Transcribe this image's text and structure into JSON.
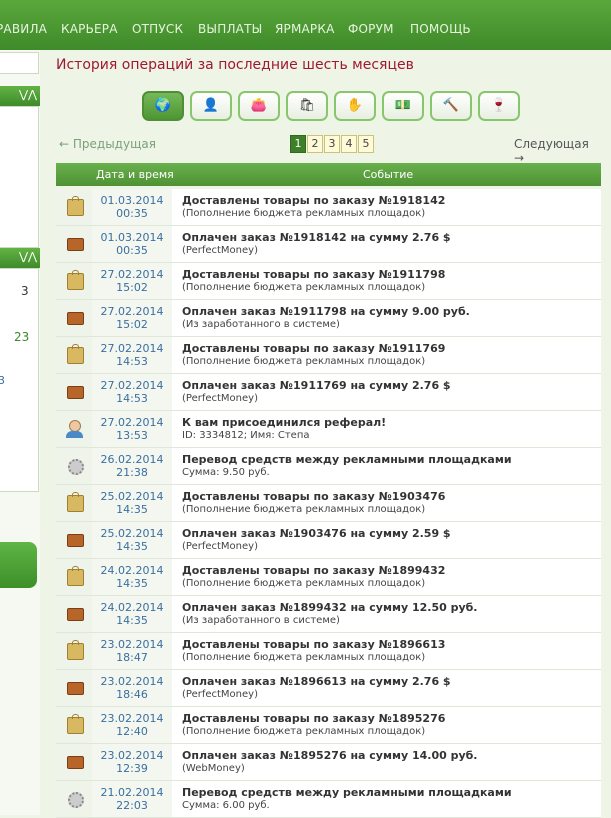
{
  "nav": [
    "РАВИЛА",
    "КАРЬЕРА",
    "ОТПУСК",
    "ВЫПЛАТЫ",
    "ЯРМАРКА",
    "ФОРУМ",
    "ПОМОЩЬ"
  ],
  "left": {
    "n1": "3",
    "n2": "23",
    "n3": "3"
  },
  "page_title": "История операций за последние шесть месяцев",
  "filters": [
    "globe-icon",
    "user-icon",
    "wallet-icon",
    "bag-icon",
    "hand-icon",
    "money-icon",
    "hammer-icon",
    "wine-icon"
  ],
  "pager": {
    "prev": "← Предыдущая",
    "next": "Следующая →",
    "pages": [
      "1",
      "2",
      "3",
      "4",
      "5"
    ],
    "current": "1"
  },
  "table": {
    "col_date": "Дата и время",
    "col_event": "Событие",
    "rows": [
      {
        "icon": "bag",
        "date": "01.03.2014",
        "time": "00:35",
        "title": "Доставлены товары по заказу №1918142",
        "sub": "(Пополнение бюджета рекламных площадок)"
      },
      {
        "icon": "wallet",
        "date": "01.03.2014",
        "time": "00:35",
        "title": "Оплачен заказ №1918142 на сумму 2.76 $",
        "sub": "(PerfectMoney)"
      },
      {
        "icon": "bag",
        "date": "27.02.2014",
        "time": "15:02",
        "title": "Доставлены товары по заказу №1911798",
        "sub": "(Пополнение бюджета рекламных площадок)"
      },
      {
        "icon": "wallet",
        "date": "27.02.2014",
        "time": "15:02",
        "title": "Оплачен заказ №1911798 на сумму 9.00 руб.",
        "sub": "(Из заработанного в системе)"
      },
      {
        "icon": "bag",
        "date": "27.02.2014",
        "time": "14:53",
        "title": "Доставлены товары по заказу №1911769",
        "sub": "(Пополнение бюджета рекламных площадок)"
      },
      {
        "icon": "wallet",
        "date": "27.02.2014",
        "time": "14:53",
        "title": "Оплачен заказ №1911769 на сумму 2.76 $",
        "sub": "(PerfectMoney)"
      },
      {
        "icon": "user",
        "date": "27.02.2014",
        "time": "13:53",
        "title": "К вам присоединился реферал!",
        "sub": "ID: 3334812; Имя: Степа"
      },
      {
        "icon": "gear",
        "date": "26.02.2014",
        "time": "21:38",
        "title": "Перевод средств между рекламными площадками",
        "sub": "Сумма: 9.50 руб."
      },
      {
        "icon": "bag",
        "date": "25.02.2014",
        "time": "14:35",
        "title": "Доставлены товары по заказу №1903476",
        "sub": "(Пополнение бюджета рекламных площадок)"
      },
      {
        "icon": "wallet",
        "date": "25.02.2014",
        "time": "14:35",
        "title": "Оплачен заказ №1903476 на сумму 2.59 $",
        "sub": "(PerfectMoney)"
      },
      {
        "icon": "bag",
        "date": "24.02.2014",
        "time": "14:35",
        "title": "Доставлены товары по заказу №1899432",
        "sub": "(Пополнение бюджета рекламных площадок)"
      },
      {
        "icon": "wallet",
        "date": "24.02.2014",
        "time": "14:35",
        "title": "Оплачен заказ №1899432 на сумму 12.50 руб.",
        "sub": "(Из заработанного в системе)"
      },
      {
        "icon": "bag",
        "date": "23.02.2014",
        "time": "18:47",
        "title": "Доставлены товары по заказу №1896613",
        "sub": "(Пополнение бюджета рекламных площадок)"
      },
      {
        "icon": "wallet",
        "date": "23.02.2014",
        "time": "18:46",
        "title": "Оплачен заказ №1896613 на сумму 2.76 $",
        "sub": "(PerfectMoney)"
      },
      {
        "icon": "bag",
        "date": "23.02.2014",
        "time": "12:40",
        "title": "Доставлены товары по заказу №1895276",
        "sub": "(Пополнение бюджета рекламных площадок)"
      },
      {
        "icon": "wallet",
        "date": "23.02.2014",
        "time": "12:39",
        "title": "Оплачен заказ №1895276 на сумму 14.00 руб.",
        "sub": "(WebMoney)"
      },
      {
        "icon": "gear",
        "date": "21.02.2014",
        "time": "22:03",
        "title": "Перевод средств между рекламными площадками",
        "sub": "Сумма: 6.00 руб."
      }
    ]
  }
}
